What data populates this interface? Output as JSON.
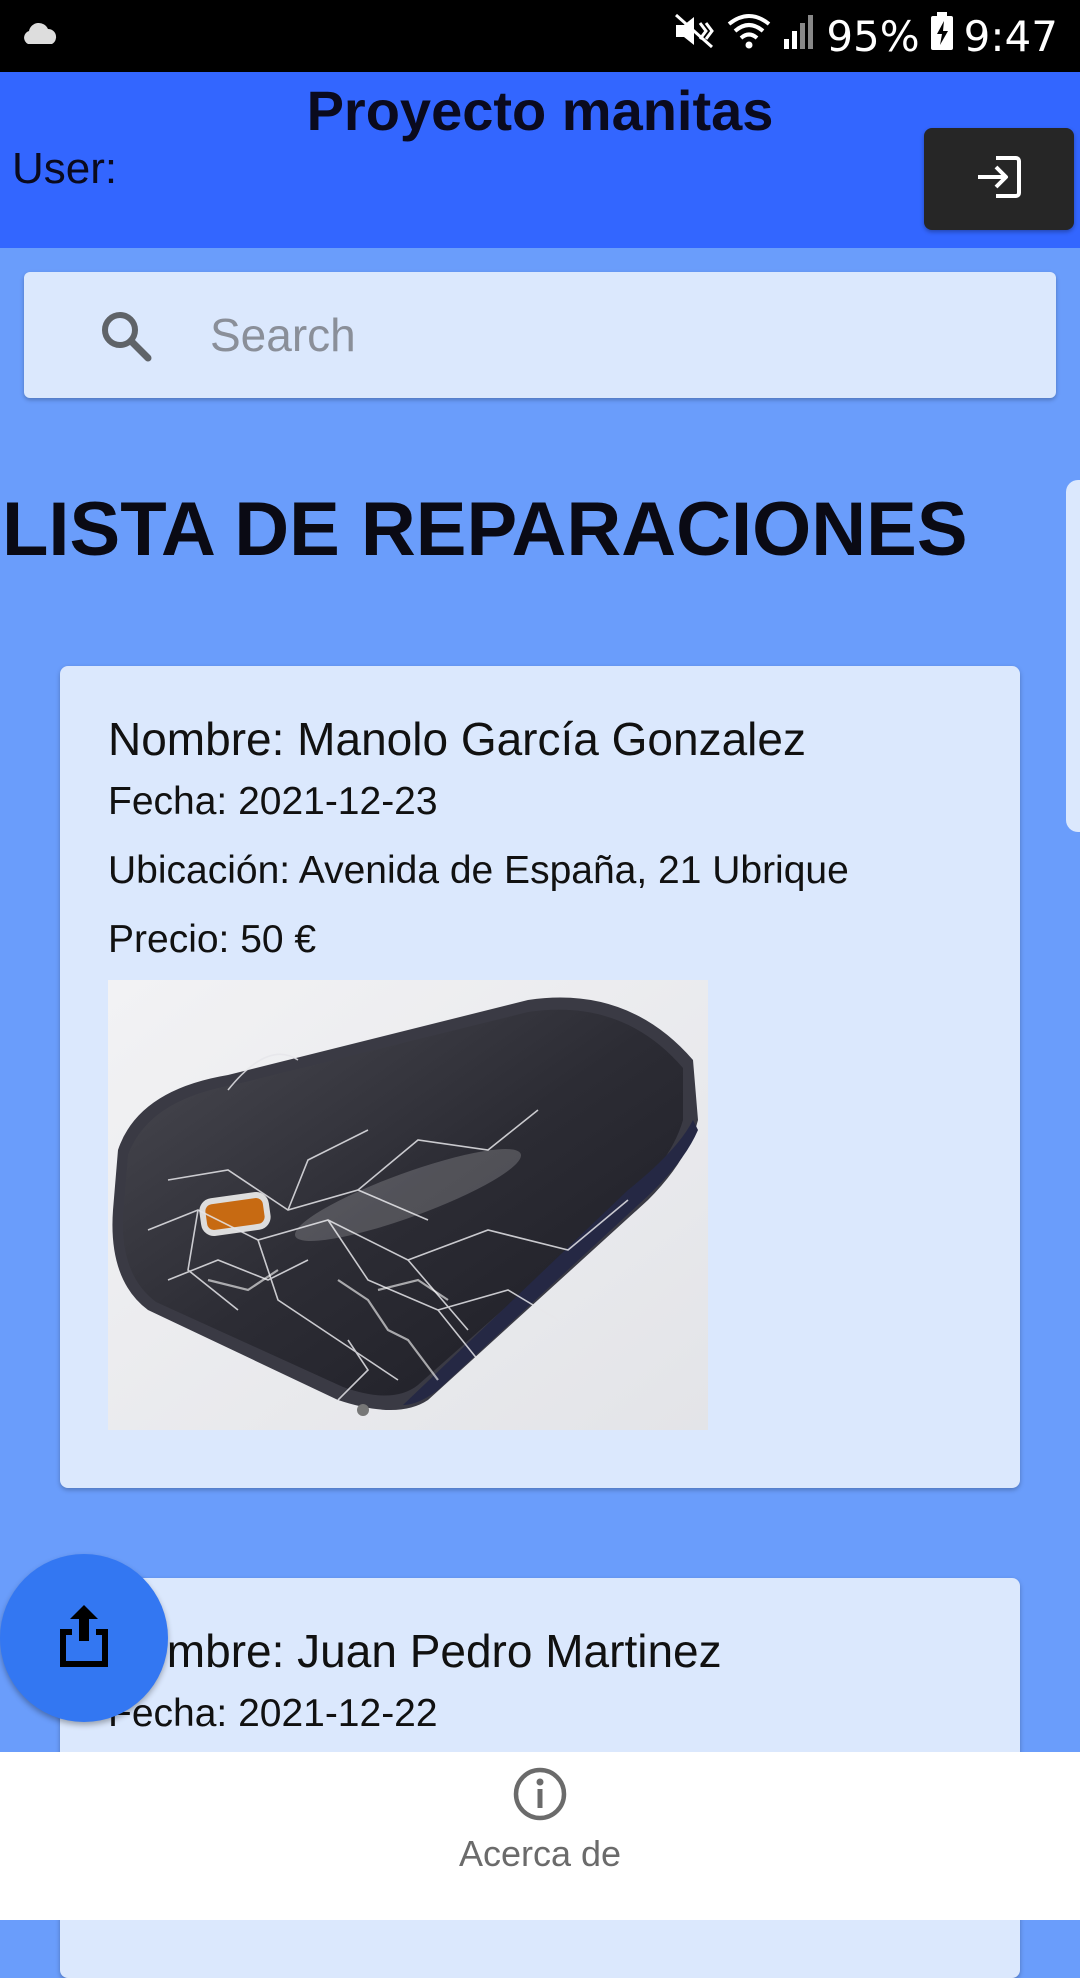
{
  "status_bar": {
    "battery": "95%",
    "time": "9:47",
    "icons": [
      "cloud-icon",
      "mute-icon",
      "wifi-icon",
      "signal-icon",
      "battery-charging-icon"
    ]
  },
  "header": {
    "title": "Proyecto manitas",
    "user_label": "User:",
    "login_icon": "login-icon"
  },
  "search": {
    "placeholder": "Search",
    "value": "",
    "icon": "search-icon"
  },
  "list": {
    "title": "LISTA DE REPARACIONES",
    "items": [
      {
        "nombre": "Nombre: Manolo García Gonzalez",
        "fecha": "Fecha: 2021-12-23",
        "ubicacion": "Ubicación: Avenida de España, 21 Ubrique",
        "precio": "Precio: 50 €",
        "image": "broken-phone-photo"
      },
      {
        "nombre": "Nombre: Juan Pedro Martinez",
        "fecha": "Fecha: 2021-12-22"
      }
    ]
  },
  "fab": {
    "icon": "share-upload-icon"
  },
  "bottom_nav": {
    "items": [
      {
        "label": "Acerca de",
        "icon": "info-icon"
      }
    ]
  },
  "colors": {
    "app_bar": "#3366ff",
    "background": "#6a9dfb",
    "card": "#dbe8fd",
    "fab": "#3377f2",
    "login_button": "#262626"
  }
}
